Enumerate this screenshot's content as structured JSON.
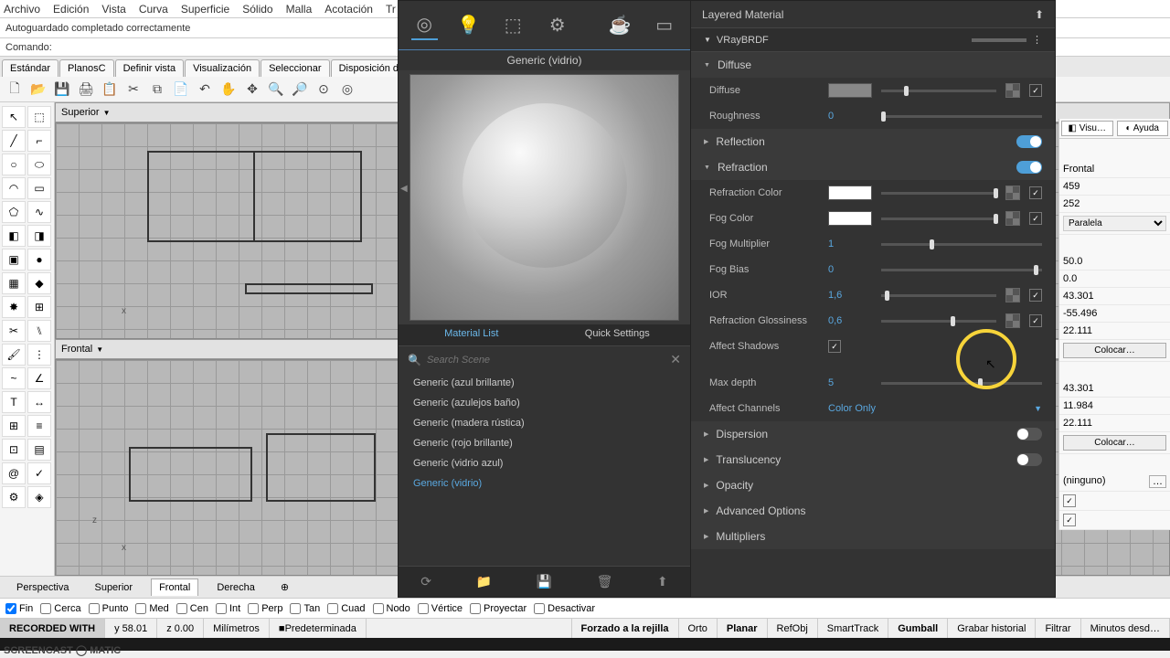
{
  "menu": [
    "Archivo",
    "Edición",
    "Vista",
    "Curva",
    "Superficie",
    "Sólido",
    "Malla",
    "Acotación",
    "Tr"
  ],
  "infobar": "Autoguardado completado correctamente",
  "cmdbar_label": "Comando:",
  "tabs": [
    "Estándar",
    "PlanosC",
    "Definir vista",
    "Visualización",
    "Seleccionar",
    "Disposición de"
  ],
  "viewport_top": "Superior",
  "viewport_bottom": "Frontal",
  "axis_x": "x",
  "axis_z": "z",
  "material_panel": {
    "title": "Layered Material",
    "preview_name": "Generic (vidrio)",
    "brdf": "VRayBRDF",
    "tab_list": "Material List",
    "tab_quick": "Quick Settings",
    "search_placeholder": "Search Scene",
    "mats": [
      "Generic (azul brillante)",
      "Generic (azulejos baño)",
      "Generic (madera rústica)",
      "Generic (rojo brillante)",
      "Generic (vidrio azul)",
      "Generic (vidrio)"
    ],
    "diffuse_head": "Diffuse",
    "diffuse_label": "Diffuse",
    "roughness_label": "Roughness",
    "roughness_val": "0",
    "reflection_head": "Reflection",
    "refraction_head": "Refraction",
    "refr_color": "Refraction Color",
    "fog_color": "Fog Color",
    "fog_mult": "Fog Multiplier",
    "fog_mult_val": "1",
    "fog_bias": "Fog Bias",
    "fog_bias_val": "0",
    "ior": "IOR",
    "ior_val": "1,6",
    "refr_gloss": "Refraction Glossiness",
    "refr_gloss_val": "0,6",
    "affect_shadows": "Affect Shadows",
    "max_depth": "Max depth",
    "max_depth_val": "5",
    "affect_channels": "Affect Channels",
    "affect_channels_val": "Color Only",
    "dispersion": "Dispersion",
    "translucency": "Translucency",
    "opacity": "Opacity",
    "advanced": "Advanced Options",
    "multipliers": "Multipliers"
  },
  "right_props": {
    "tab_visu": "Visu…",
    "tab_ayuda": "Ayuda",
    "frontal": "Frontal",
    "v459": "459",
    "v252": "252",
    "paralela": "Paralela",
    "v50": "50.0",
    "v00": "0.0",
    "v43a": "43.301",
    "v55": "-55.496",
    "v22a": "22.111",
    "colocar": "Colocar…",
    "v43b": "43.301",
    "v11": "11.984",
    "v22b": "22.111",
    "ninguno": "(ninguno)"
  },
  "vp_tabs": [
    "Perspectiva",
    "Superior",
    "Frontal",
    "Derecha"
  ],
  "snaps": [
    "Fin",
    "Cerca",
    "Punto",
    "Med",
    "Cen",
    "Int",
    "Perp",
    "Tan",
    "Cuad",
    "Nodo",
    "Vértice",
    "Proyectar",
    "Desactivar"
  ],
  "status": {
    "recorded": "RECORDED WITH",
    "y": "y 58.01",
    "z": "z 0.00",
    "units": "Milímetros",
    "layer": "Predeterminada",
    "snap": "Forzado a la rejilla",
    "orto": "Orto",
    "planar": "Planar",
    "refobj": "RefObj",
    "smart": "SmartTrack",
    "gumball": "Gumball",
    "hist": "Grabar historial",
    "filter": "Filtrar",
    "time": "Minutos desd…"
  },
  "watermark": "SCREENCAST ◯ MATIC"
}
